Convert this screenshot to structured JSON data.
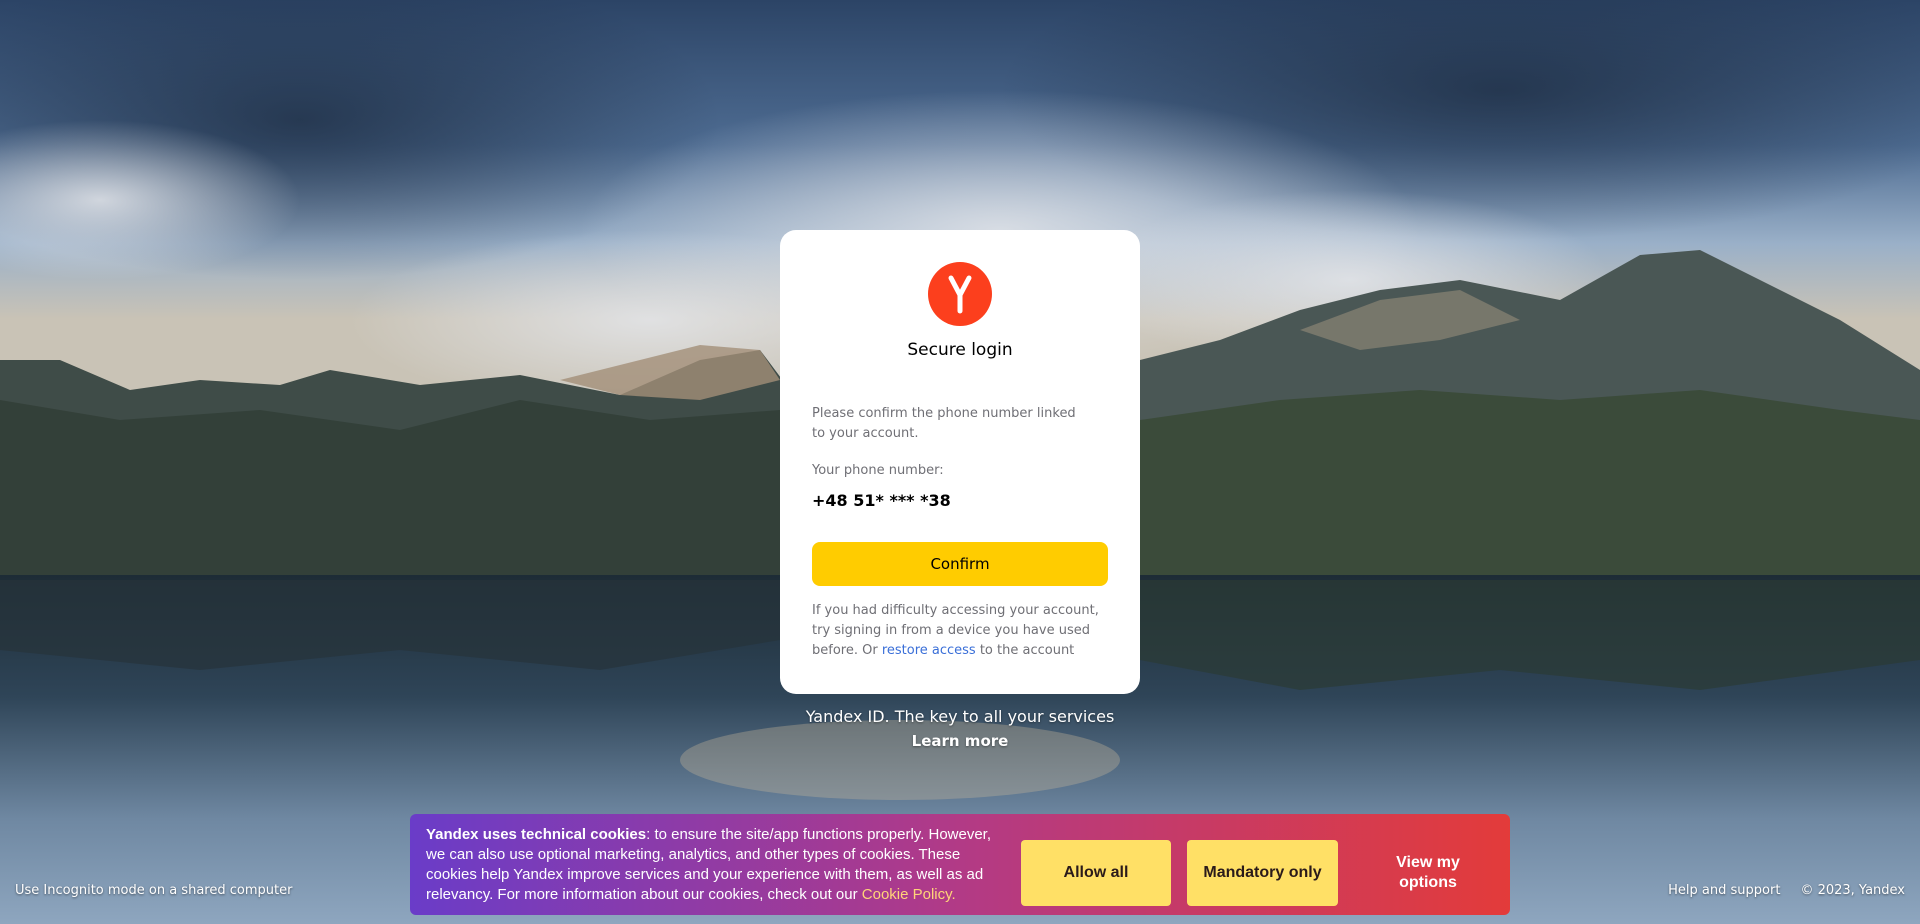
{
  "card": {
    "title": "Secure login",
    "prompt": "Please confirm the phone number linked to your account.",
    "phone_label": "Your phone number:",
    "phone_value": "+48 51* *** *38",
    "confirm_label": "Confirm",
    "help_part1": "If you had difficulty accessing your account, try signing in from a device you have used before. Or ",
    "help_link": "restore access",
    "help_part2": " to the account"
  },
  "promo": {
    "tagline": "Yandex ID. The key to all your services",
    "learn_more": "Learn more"
  },
  "footer": {
    "incognito_hint": "Use Incognito mode on a shared computer",
    "help": "Help and support",
    "copyright": "© 2023, Yandex"
  },
  "cookie": {
    "bold": "Yandex uses technical cookies",
    "body": ": to ensure the site/app functions properly. However, we can also use optional marketing, analytics, and other types of cookies. These cookies help Yandex improve services and your experience with them, as well as ad relevancy. For more information about our cookies, check out our ",
    "policy_link": "Cookie Policy.",
    "allow_all": "Allow all",
    "mandatory_only": "Mandatory only",
    "view_options": "View my options"
  },
  "colors": {
    "brand_red": "#fc3f1d",
    "confirm_yellow": "#ffcc00",
    "link_blue": "#3a6fd8"
  },
  "icons": {
    "logo": "yandex-logo-icon"
  }
}
